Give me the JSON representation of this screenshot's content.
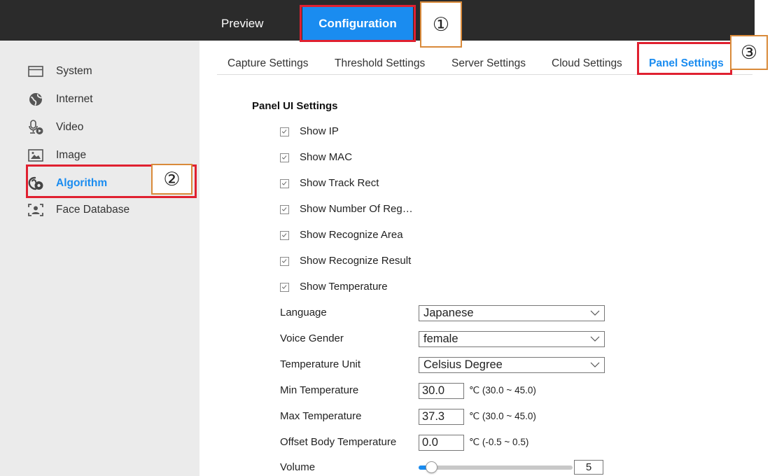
{
  "topbar": {
    "preview_tab": "Preview",
    "config_tab": "Configuration",
    "annotation": "①"
  },
  "sidebar": {
    "items": [
      {
        "label": "System",
        "icon": "window-icon",
        "active": false
      },
      {
        "label": "Internet",
        "icon": "globe-icon",
        "active": false
      },
      {
        "label": "Video",
        "icon": "video-icon",
        "active": false
      },
      {
        "label": "Image",
        "icon": "image-icon",
        "active": false
      },
      {
        "label": "Algorithm",
        "icon": "algorithm-icon",
        "active": true
      },
      {
        "label": "Face Database",
        "icon": "face-database-icon",
        "active": false
      }
    ],
    "annotation": "②"
  },
  "subtabs": {
    "items": [
      {
        "label": "Capture Settings",
        "active": false
      },
      {
        "label": "Threshold Settings",
        "active": false
      },
      {
        "label": "Server Settings",
        "active": false
      },
      {
        "label": "Cloud Settings",
        "active": false
      },
      {
        "label": "Panel Settings",
        "active": true
      }
    ],
    "annotation": "③"
  },
  "panel": {
    "section_title": "Panel UI Settings",
    "checkboxes": [
      {
        "label": "Show IP",
        "checked": true
      },
      {
        "label": "Show MAC",
        "checked": true
      },
      {
        "label": "Show Track Rect",
        "checked": true
      },
      {
        "label": "Show Number Of Reg…",
        "checked": true
      },
      {
        "label": "Show Recognize Area",
        "checked": true
      },
      {
        "label": "Show Recognize Result",
        "checked": true
      },
      {
        "label": "Show Temperature",
        "checked": true
      }
    ],
    "language": {
      "label": "Language",
      "value": "Japanese"
    },
    "voice_gender": {
      "label": "Voice Gender",
      "value": "female"
    },
    "temperature_unit": {
      "label": "Temperature Unit",
      "value": "Celsius Degree"
    },
    "min_temperature": {
      "label": "Min Temperature",
      "value": "30.0",
      "range": "℃ (30.0 ~ 45.0)"
    },
    "max_temperature": {
      "label": "Max Temperature",
      "value": "37.3",
      "range": "℃ (30.0 ~ 45.0)"
    },
    "offset_body_temperature": {
      "label": "Offset Body Temperature",
      "value": "0.0",
      "range": "℃ (-0.5 ~ 0.5)"
    },
    "volume": {
      "label": "Volume",
      "value": "5",
      "level": 0.05
    }
  },
  "colors": {
    "accent": "#1a8cf0",
    "highlight_border": "#e02030",
    "annotation_border": "#d98a3a",
    "topbar_bg": "#2b2b2b",
    "sidebar_bg": "#ebebeb"
  }
}
